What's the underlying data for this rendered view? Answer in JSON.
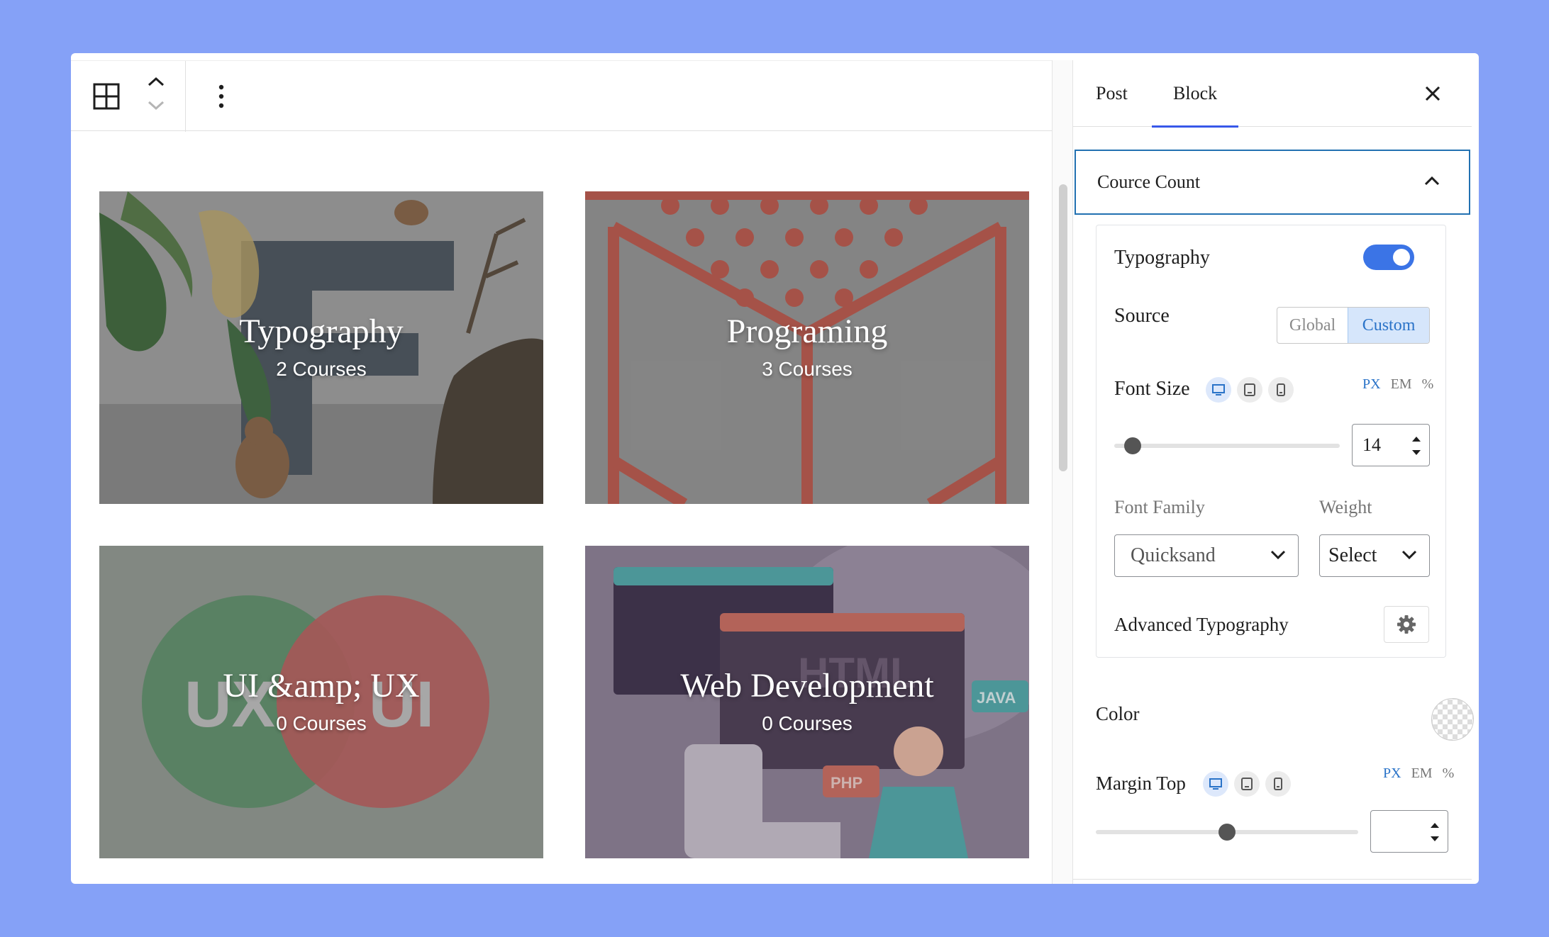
{
  "toolbar": {
    "block_icon": "table-grid-icon",
    "move_up_icon": "chevron-up-icon",
    "move_down_icon": "chevron-down-icon",
    "options_icon": "vertical-ellipsis-icon"
  },
  "cards": [
    {
      "title": "Typography",
      "count": "2 Courses"
    },
    {
      "title": "Programing",
      "count": "3 Courses"
    },
    {
      "title": "UI &amp; UX",
      "count": "0 Courses",
      "art_left": "UX",
      "art_right": "UI"
    },
    {
      "title": "Web Development",
      "count": "0 Courses",
      "art_code": "HTML",
      "art_java": "JAVA",
      "art_php": "PHP"
    }
  ],
  "sidebar": {
    "tabs": [
      {
        "label": "Post",
        "active": false
      },
      {
        "label": "Block",
        "active": true
      }
    ],
    "close_icon": "close-icon",
    "panel_title": "Cource Count",
    "typography": {
      "label": "Typography",
      "enabled": true,
      "source_label": "Source",
      "source_options": [
        "Global",
        "Custom"
      ],
      "source_selected": "Custom",
      "font_size_label": "Font Size",
      "units": [
        "PX",
        "EM",
        "%"
      ],
      "unit_selected": "PX",
      "font_size_value": "14",
      "font_family_label": "Font Family",
      "font_family_value": "Quicksand",
      "weight_label": "Weight",
      "weight_value": "Select",
      "advanced_label": "Advanced Typography"
    },
    "color_label": "Color",
    "margin_top": {
      "label": "Margin Top",
      "units": [
        "PX",
        "EM",
        "%"
      ],
      "unit_selected": "PX",
      "value": ""
    }
  },
  "colors": {
    "background": "#85a1f7",
    "accent": "#3b74e6",
    "panel_border": "#2271b1"
  }
}
